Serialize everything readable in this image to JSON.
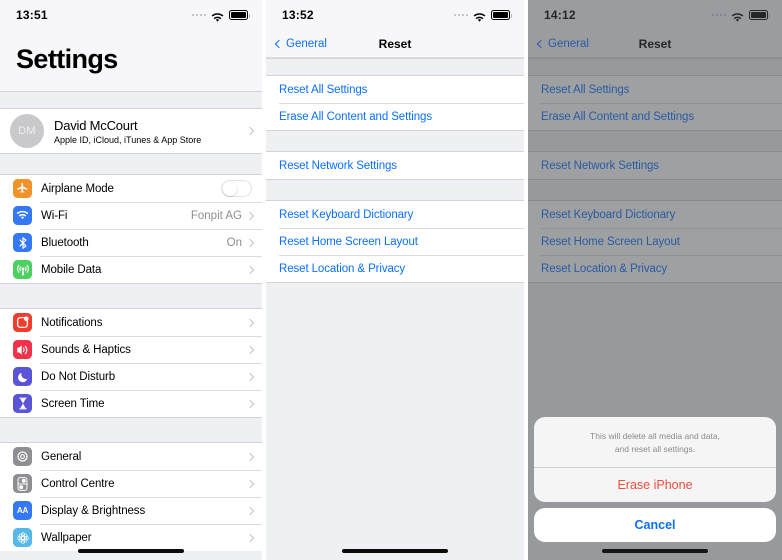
{
  "panel1": {
    "status": {
      "time": "13:51",
      "signal_icon": "signal-dots-icon",
      "wifi_icon": "wifi-icon",
      "battery_icon": "battery-full-icon"
    },
    "title": "Settings",
    "account": {
      "initials": "DM",
      "name": "David McCourt",
      "subtitle": "Apple ID, iCloud, iTunes & App Store"
    },
    "group_connectivity": [
      {
        "label": "Airplane Mode",
        "icon": "airplane-icon",
        "color": "#f0932a",
        "control": "toggle",
        "toggle_on": false
      },
      {
        "label": "Wi-Fi",
        "icon": "wifi-icon",
        "color": "#3478f6",
        "value": "Fonpit AG",
        "control": "chevron"
      },
      {
        "label": "Bluetooth",
        "icon": "bluetooth-icon",
        "color": "#3478f6",
        "value": "On",
        "control": "chevron"
      },
      {
        "label": "Mobile Data",
        "icon": "antenna-icon",
        "color": "#4cd060",
        "value": "",
        "control": "chevron"
      }
    ],
    "group_alerts": [
      {
        "label": "Notifications",
        "icon": "notifications-icon",
        "color": "#f03d2e",
        "value": "",
        "control": "chevron"
      },
      {
        "label": "Sounds & Haptics",
        "icon": "speaker-icon",
        "color": "#f0334b",
        "value": "",
        "control": "chevron"
      },
      {
        "label": "Do Not Disturb",
        "icon": "moon-icon",
        "color": "#5a55d6",
        "value": "",
        "control": "chevron"
      },
      {
        "label": "Screen Time",
        "icon": "hourglass-icon",
        "color": "#5a55d6",
        "value": "",
        "control": "chevron"
      }
    ],
    "group_system": [
      {
        "label": "General",
        "icon": "gear-icon",
        "color": "#8e8e93",
        "value": "",
        "control": "chevron"
      },
      {
        "label": "Control Centre",
        "icon": "control-centre-icon",
        "color": "#8e8e93",
        "value": "",
        "control": "chevron"
      },
      {
        "label": "Display & Brightness",
        "icon": "display-aa-icon",
        "color": "#3478f6",
        "value": "",
        "control": "chevron"
      },
      {
        "label": "Wallpaper",
        "icon": "wallpaper-flower-icon",
        "color": "#55b8e8",
        "value": "",
        "control": "chevron"
      }
    ]
  },
  "panel2": {
    "status": {
      "time": "13:52"
    },
    "nav": {
      "back_label": "General",
      "title": "Reset"
    },
    "group_a": [
      "Reset All Settings",
      "Erase All Content and Settings"
    ],
    "group_b": [
      "Reset Network Settings"
    ],
    "group_c": [
      "Reset Keyboard Dictionary",
      "Reset Home Screen Layout",
      "Reset Location & Privacy"
    ]
  },
  "panel3": {
    "status": {
      "time": "14:12"
    },
    "nav": {
      "back_label": "General",
      "title": "Reset"
    },
    "group_a": [
      "Reset All Settings",
      "Erase All Content and Settings"
    ],
    "group_b": [
      "Reset Network Settings"
    ],
    "group_c": [
      "Reset Keyboard Dictionary",
      "Reset Home Screen Layout",
      "Reset Location & Privacy"
    ],
    "sheet": {
      "message_line1": "This will delete all media and data,",
      "message_line2": "and reset all settings.",
      "destructive_label": "Erase iPhone",
      "cancel_label": "Cancel",
      "destructive_color": "#ef4b41",
      "cancel_color": "#0a6fff"
    }
  }
}
